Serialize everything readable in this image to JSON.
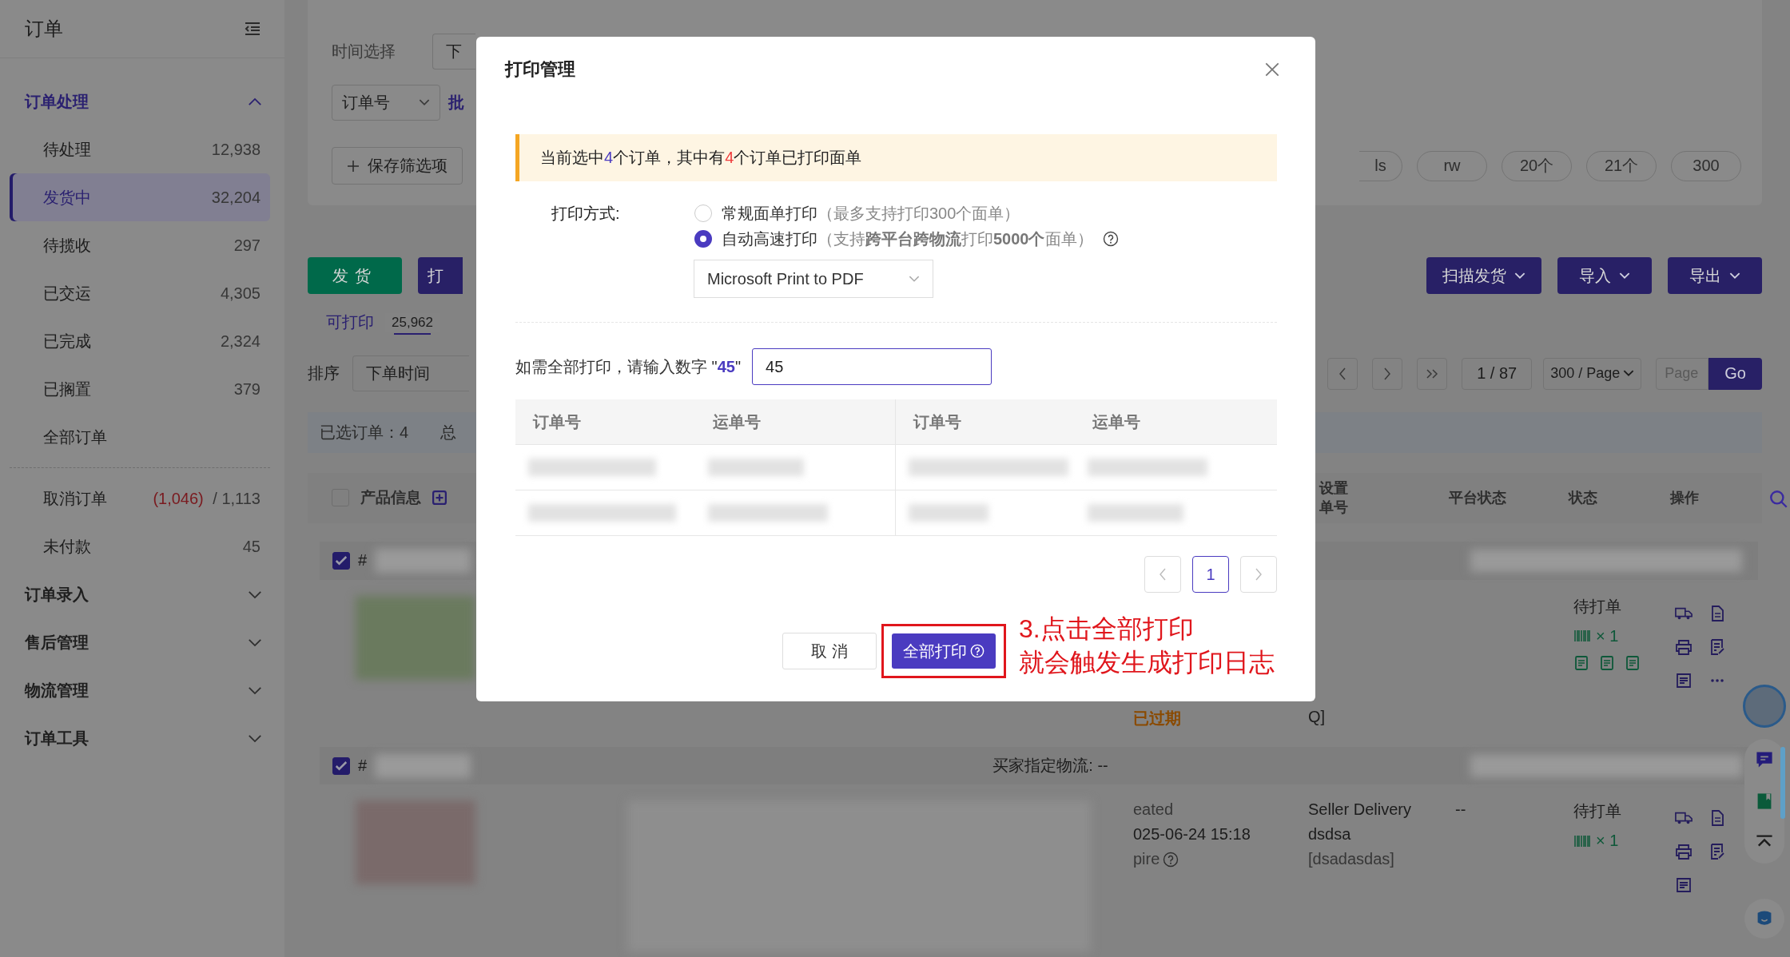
{
  "sidebar": {
    "title": "订单",
    "groups": [
      {
        "label": "订单处理",
        "expanded": true,
        "items": [
          {
            "label": "待处理",
            "count": "12,938",
            "selected": false
          },
          {
            "label": "发货中",
            "count": "32,204",
            "selected": true
          },
          {
            "label": "待揽收",
            "count": "297",
            "selected": false
          },
          {
            "label": "已交运",
            "count": "4,305",
            "selected": false
          },
          {
            "label": "已完成",
            "count": "2,324",
            "selected": false
          },
          {
            "label": "已搁置",
            "count": "379",
            "selected": false
          },
          {
            "label": "全部订单",
            "selected": false
          }
        ],
        "more_items": [
          {
            "label": "取消订单",
            "alert_count": "(1,046)",
            "count": "/ 1,113",
            "selected": false
          },
          {
            "label": "未付款",
            "count": "45",
            "selected": false
          }
        ]
      },
      {
        "label": "订单录入",
        "expanded": false
      },
      {
        "label": "售后管理",
        "expanded": false
      },
      {
        "label": "物流管理",
        "expanded": false
      },
      {
        "label": "订单工具",
        "expanded": false
      }
    ]
  },
  "filters": {
    "time_label": "时间选择",
    "time_select": "下",
    "field_select": "订单号",
    "batch_text": "批",
    "save_button": "保存筛选项",
    "chips": [
      "ls",
      "rw",
      "20个",
      "21个",
      "300"
    ]
  },
  "actions": {
    "left": [
      {
        "label": "发货",
        "kind": "ship"
      },
      {
        "label": "打",
        "kind": "primary"
      }
    ],
    "right": [
      "扫描发货",
      "导入",
      "导出"
    ]
  },
  "tabs": [
    {
      "label": "可打印",
      "count": "25,962",
      "selected": true
    }
  ],
  "sort": {
    "label": "排序",
    "value": "下单时间"
  },
  "pagination": {
    "page": "1 / 87",
    "page_size": "300 / Page",
    "jump_placeholder": "Page",
    "go": "Go"
  },
  "selection_bar": {
    "selected": "已选订单：4",
    "total": "总"
  },
  "table": {
    "select_all": false,
    "product_column": "产品信息",
    "columns_right": [
      {
        "lines": [
          "设置",
          "单号"
        ]
      },
      {
        "lines": [
          "平台状态"
        ]
      },
      {
        "lines": [
          "状态"
        ]
      },
      {
        "lines": [
          "操作"
        ]
      }
    ]
  },
  "orders": [
    {
      "checked": true,
      "number_prefix": "#",
      "status": "待打单",
      "quantity": "× 1",
      "expired": "已过期",
      "tail": "Q]"
    },
    {
      "checked": true,
      "number_prefix": "#",
      "logistics": "买家指定物流: --",
      "created": "eated",
      "date": "025-06-24 15:18",
      "expire": "pire",
      "delivery": [
        "Seller Delivery",
        "dsdsa",
        "[dsadasdas]"
      ],
      "platform_status": "--",
      "status": "待打单",
      "quantity": "× 1"
    }
  ],
  "modal": {
    "title": "打印管理",
    "alert": [
      {
        "text": "当前选中",
        "kind": "normal"
      },
      {
        "text": "4",
        "kind": "accent"
      },
      {
        "text": "个订单，其中有",
        "kind": "normal"
      },
      {
        "text": "4",
        "kind": "danger"
      },
      {
        "text": "个订单已打印面单",
        "kind": "normal"
      }
    ],
    "method_label": "打印方式:",
    "methods": [
      {
        "label": "常规面单打印",
        "hint": "（最多支持打印300个面单）",
        "selected": false,
        "help": false
      },
      {
        "label": "自动高速打印",
        "hint": "（支持**跨平台跨物流**打印**5000个**面单）",
        "selected": true,
        "help": true
      }
    ],
    "printer": "Microsoft Print to PDF",
    "confirm_label": "如需全部打印，请输入数字 \"**45**\"",
    "confirm_value": "45",
    "columns": [
      "订单号",
      "运单号",
      "订单号",
      "运单号"
    ],
    "pages": [
      {
        "label": "1",
        "selected": true
      }
    ],
    "cancel": "取 消",
    "print_all": "全部打印"
  },
  "annotation": [
    "3.点击全部打印",
    "就会触发生成打印日志"
  ]
}
